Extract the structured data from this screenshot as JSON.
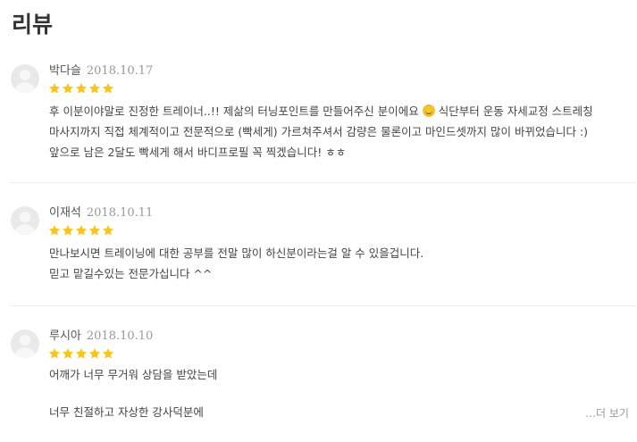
{
  "header": {
    "title": "리뷰"
  },
  "colors": {
    "star": "#f8c51c",
    "divider": "#ececec",
    "date": "#999999",
    "avatar": "#e9e9e9"
  },
  "reviews": [
    {
      "name": "박다슬",
      "date": "2018.10.17",
      "rating": 5,
      "lines": [
        "후 이분이야말로 진정한 트레이너..!! 제삶의 터닝포인트를 만들어주신 분이에요",
        "식단부터 운동 자세교정 스트레칭",
        "마사지까지 직접 체계적이고 전문적으로 (빡세게) 가르쳐주셔서 감량은 물론이고 마인드셋까지 많이 바뀌었습니다 :)",
        "앞으로 남은 2달도 빡세게 해서 바디프로필 꼭 찍겠습니다! ㅎㅎ"
      ],
      "emoji": "grinning-face-emoji"
    },
    {
      "name": "이재석",
      "date": "2018.10.11",
      "rating": 5,
      "lines": [
        "만나보시면 트레이닝에 대한 공부를 전말 많이 하신분이라는걸 알 수 있을겁니다.",
        "믿고 맡길수있는 전문가십니다 ^^"
      ]
    },
    {
      "name": "루시아",
      "date": "2018.10.10",
      "rating": 5,
      "lines": [
        "어깨가 너무 무거워 상담을 받았는데",
        "너무 친절하고 자상한 강사덕분에"
      ],
      "more_label": "…더 보기"
    }
  ]
}
